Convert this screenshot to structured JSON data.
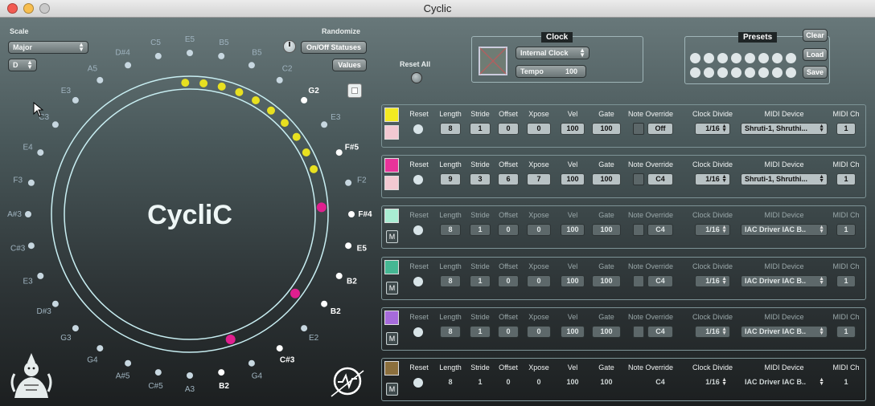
{
  "window": {
    "title": "Cyclic"
  },
  "scale": {
    "label": "Scale",
    "type_value": "Major",
    "root_value": "D"
  },
  "randomize": {
    "label": "Randomize",
    "onoff_button": "On/Off Statuses",
    "values_button": "Values"
  },
  "reset_all": {
    "label": "Reset All"
  },
  "logo": {
    "text": "CycliC"
  },
  "circle_notes": [
    {
      "label": "E5",
      "color": "#9fb3bf"
    },
    {
      "label": "B5",
      "color": "#9fb3bf"
    },
    {
      "label": "B5",
      "color": "#9fb3bf"
    },
    {
      "label": "C2",
      "color": "#9fb3bf"
    },
    {
      "label": "G2",
      "color": "#ffffff"
    },
    {
      "label": "E3",
      "color": "#9fb3bf"
    },
    {
      "label": "F#5",
      "color": "#ffffff"
    },
    {
      "label": "F2",
      "color": "#9fb3bf"
    },
    {
      "label": "F#4",
      "color": "#ffffff"
    },
    {
      "label": "E5",
      "color": "#ffffff"
    },
    {
      "label": "B2",
      "color": "#ffffff"
    },
    {
      "label": "B2",
      "color": "#ffffff"
    },
    {
      "label": "E2",
      "color": "#9fb3bf"
    },
    {
      "label": "C#3",
      "color": "#ffffff"
    },
    {
      "label": "G4",
      "color": "#9fb3bf"
    },
    {
      "label": "B2",
      "color": "#ffffff"
    },
    {
      "label": "A3",
      "color": "#9fb3bf"
    },
    {
      "label": "C#5",
      "color": "#9fb3bf"
    },
    {
      "label": "A#5",
      "color": "#9fb3bf"
    },
    {
      "label": "G4",
      "color": "#9fb3bf"
    },
    {
      "label": "G3",
      "color": "#9fb3bf"
    },
    {
      "label": "D#3",
      "color": "#9fb3bf"
    },
    {
      "label": "E3",
      "color": "#9fb3bf"
    },
    {
      "label": "C#3",
      "color": "#9fb3bf"
    },
    {
      "label": "A#3",
      "color": "#9fb3bf"
    },
    {
      "label": "F3",
      "color": "#9fb3bf"
    },
    {
      "label": "E4",
      "color": "#9fb3bf"
    },
    {
      "label": "C3",
      "color": "#9fb3bf"
    },
    {
      "label": "E3",
      "color": "#9fb3bf"
    },
    {
      "label": "A5",
      "color": "#9fb3bf"
    },
    {
      "label": "D#4",
      "color": "#9fb3bf"
    },
    {
      "label": "C5",
      "color": "#9fb3bf"
    }
  ],
  "step_markers": [
    {
      "color": "#e8e020"
    },
    {
      "color": "#e8e020"
    },
    {
      "color": "#e8e020"
    },
    {
      "color": "#e8e020"
    },
    {
      "color": "#e8e020"
    },
    {
      "color": "#e8e020"
    },
    {
      "color": "#e8e020"
    },
    {
      "color": "#e8e020"
    },
    {
      "color": "#e8e020"
    },
    {
      "color": "#e8e020"
    },
    {
      "color": "#e01f8f"
    },
    {
      "color": "#e01f8f"
    },
    {
      "color": "#e01f8f"
    }
  ],
  "clock": {
    "title": "Clock",
    "source_value": "Internal Clock",
    "tempo_label": "Tempo",
    "tempo_value": "100"
  },
  "presets": {
    "title": "Presets",
    "clear": "Clear",
    "load": "Load",
    "save": "Save",
    "slot_count": 16
  },
  "track_headers": {
    "reset": "Reset",
    "length": "Length",
    "stride": "Stride",
    "offset": "Offset",
    "xpose": "Xpose",
    "vel": "Vel",
    "gate": "Gate",
    "note_override": "Note Override",
    "clock_divide": "Clock Divide",
    "midi_device": "MIDI Device",
    "midi_ch": "MIDI Ch"
  },
  "tracks": [
    {
      "color": "#f3ea22",
      "color2": "#f2c9d2",
      "length": "8",
      "stride": "1",
      "offset": "0",
      "xpose": "0",
      "vel": "100",
      "gate": "100",
      "note": "Off",
      "divide": "1/16",
      "device": "Shruti-1, Shruthi...",
      "channel": "1",
      "mute": ""
    },
    {
      "color": "#e8339a",
      "color2": "#f2c9d2",
      "length": "9",
      "stride": "3",
      "offset": "6",
      "xpose": "7",
      "vel": "100",
      "gate": "100",
      "note": "C4",
      "divide": "1/16",
      "device": "Shruti-1, Shruthi...",
      "channel": "1",
      "mute": ""
    },
    {
      "color": "#a9edd3",
      "length": "8",
      "stride": "1",
      "offset": "0",
      "xpose": "0",
      "vel": "100",
      "gate": "100",
      "note": "C4",
      "divide": "1/16",
      "device": "IAC Driver IAC B..",
      "channel": "1",
      "mute": "M"
    },
    {
      "color": "#45b793",
      "length": "8",
      "stride": "1",
      "offset": "0",
      "xpose": "0",
      "vel": "100",
      "gate": "100",
      "note": "C4",
      "divide": "1/16",
      "device": "IAC Driver IAC B..",
      "channel": "1",
      "mute": "M"
    },
    {
      "color": "#a66bdb",
      "length": "8",
      "stride": "1",
      "offset": "0",
      "xpose": "0",
      "vel": "100",
      "gate": "100",
      "note": "C4",
      "divide": "1/16",
      "device": "IAC Driver IAC B..",
      "channel": "1",
      "mute": "M"
    },
    {
      "color": "#8b6f3d",
      "length": "8",
      "stride": "1",
      "offset": "0",
      "xpose": "0",
      "vel": "100",
      "gate": "100",
      "note": "C4",
      "divide": "1/16",
      "device": "IAC Driver IAC B..",
      "channel": "1",
      "mute": "M"
    }
  ],
  "icons": {
    "mascot": "shiva-mascot-icon",
    "brand": "oscilloscope-logo-icon",
    "pointer": "mouse-cursor-icon"
  }
}
